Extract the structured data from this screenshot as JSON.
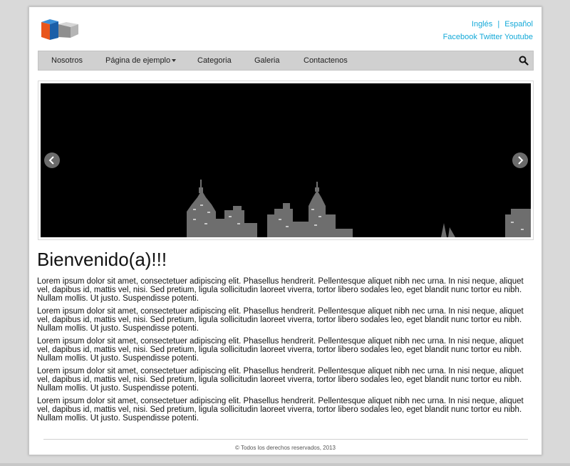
{
  "header": {
    "lang_en": "Inglés",
    "lang_sep": "|",
    "lang_es": "Español",
    "social_facebook": "Facebook",
    "social_twitter": "Twitter",
    "social_youtube": "Youtube"
  },
  "nav": {
    "items": [
      "Nosotros",
      "Página de ejemplo",
      "Categoria",
      "Galeria",
      "Contactenos"
    ]
  },
  "main": {
    "title": "Bienvenido(a)!!!",
    "paragraphs": [
      "Lorem ipsum dolor sit amet, consectetuer adipiscing elit. Phasellus hendrerit. Pellentesque aliquet nibh nec urna. In nisi neque, aliquet vel, dapibus id, mattis vel, nisi. Sed pretium, ligula sollicitudin laoreet viverra, tortor libero sodales leo, eget blandit nunc tortor eu nibh. Nullam mollis. Ut justo. Suspendisse potenti.",
      "Lorem ipsum dolor sit amet, consectetuer adipiscing elit. Phasellus hendrerit. Pellentesque aliquet nibh nec urna. In nisi neque, aliquet vel, dapibus id, mattis vel, nisi. Sed pretium, ligula sollicitudin laoreet viverra, tortor libero sodales leo, eget blandit nunc tortor eu nibh. Nullam mollis. Ut justo. Suspendisse potenti.",
      "Lorem ipsum dolor sit amet, consectetuer adipiscing elit. Phasellus hendrerit. Pellentesque aliquet nibh nec urna. In nisi neque, aliquet vel, dapibus id, mattis vel, nisi. Sed pretium, ligula sollicitudin laoreet viverra, tortor libero sodales leo, eget blandit nunc tortor eu nibh. Nullam mollis. Ut justo. Suspendisse potenti.",
      "Lorem ipsum dolor sit amet, consectetuer adipiscing elit. Phasellus hendrerit. Pellentesque aliquet nibh nec urna. In nisi neque, aliquet vel, dapibus id, mattis vel, nisi. Sed pretium, ligula sollicitudin laoreet viverra, tortor libero sodales leo, eget blandit nunc tortor eu nibh. Nullam mollis. Ut justo. Suspendisse potenti.",
      "Lorem ipsum dolor sit amet, consectetuer adipiscing elit. Phasellus hendrerit. Pellentesque aliquet nibh nec urna. In nisi neque, aliquet vel, dapibus id, mattis vel, nisi. Sed pretium, ligula sollicitudin laoreet viverra, tortor libero sodales leo, eget blandit nunc tortor eu nibh. Nullam mollis. Ut justo. Suspendisse potenti."
    ]
  },
  "footer": {
    "copyright": "© Todos los derechos reservados, 2013"
  },
  "icons": {
    "search": "search-icon",
    "prev": "chevron-left-icon",
    "next": "chevron-right-icon",
    "logo": "cube-logo"
  },
  "colors": {
    "link": "#14a9d8",
    "navbar": "#d0d0d0",
    "logo_orange": "#e8561c",
    "logo_blue": "#1b5fa8",
    "logo_gray": "#9a9a9a"
  }
}
